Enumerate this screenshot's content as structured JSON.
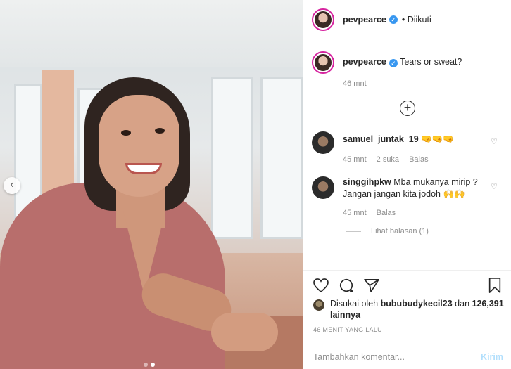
{
  "post": {
    "username": "pevpearce",
    "follow_status": "• Diikuti",
    "verified_icon": "verified-badge-icon"
  },
  "caption": {
    "username": "pevpearce",
    "text": "Tears or sweat?",
    "time": "46 mnt"
  },
  "comments": [
    {
      "username": "samuel_juntak_19",
      "text": "🤜🤜🤜",
      "time": "45 mnt",
      "likes": "2 suka",
      "reply": "Balas"
    },
    {
      "username": "singgihpkw",
      "text": "Mba mukanya mirip ? Jangan jangan kita jodoh 🙌🙌",
      "time": "45 mnt",
      "reply": "Balas",
      "view_replies": "Lihat balasan (1)"
    }
  ],
  "likes": {
    "prefix": "Disukai oleh",
    "user": "bububudykecil23",
    "conj": "dan",
    "count": "126,391",
    "suffix": "lainnya"
  },
  "timestamp": "46 MENIT YANG LALU",
  "comment_box": {
    "placeholder": "Tambahkan komentar...",
    "post_label": "Kirim"
  },
  "carousel": {
    "prev_icon": "chevron-left-icon",
    "dots": 2,
    "active_dot": 1
  },
  "colors": {
    "verified": "#3897f0",
    "post_button": "#b2dffc",
    "meta": "#8e8e8e"
  }
}
